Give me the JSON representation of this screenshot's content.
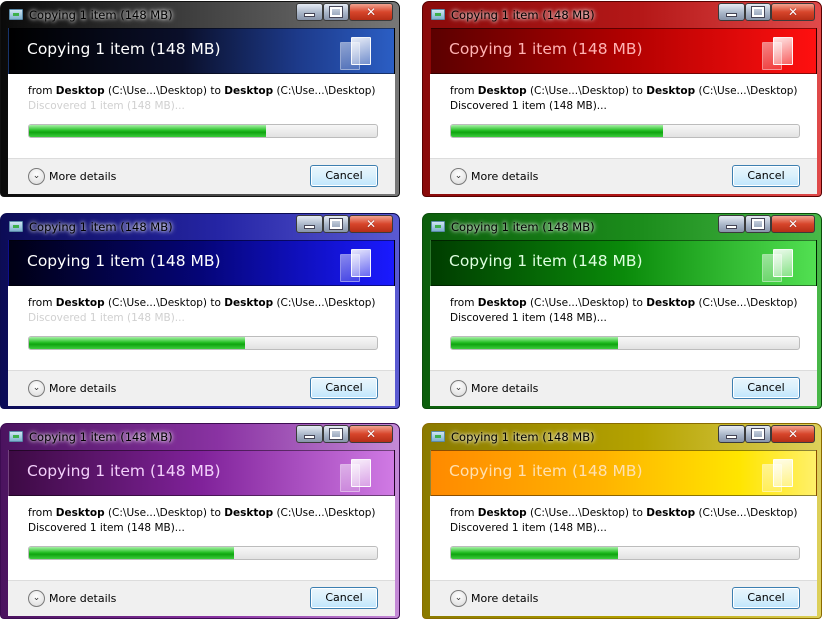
{
  "dialogs": [
    {
      "theme": "black",
      "window_title": "Copying 1 item (148 MB)",
      "heading": "Copying 1 item (148 MB)",
      "from_label": "from",
      "source_name": "Desktop",
      "source_path": "(C:\\Use...\\Desktop)",
      "to_label": "to",
      "dest_name": "Desktop",
      "dest_path": "(C:\\Use...\\Desktop)",
      "status": "Discovered 1 item (148 MB)...",
      "progress_percent": 68,
      "more_details": "More details",
      "cancel": "Cancel"
    },
    {
      "theme": "red",
      "window_title": "Copying 1 item (148 MB)",
      "heading": "Copying 1 item (148 MB)",
      "from_label": "from",
      "source_name": "Desktop",
      "source_path": "(C:\\Use...\\Desktop)",
      "to_label": "to",
      "dest_name": "Desktop",
      "dest_path": "(C:\\Use...\\Desktop)",
      "status": "Discovered 1 item (148 MB)...",
      "progress_percent": 61,
      "more_details": "More details",
      "cancel": "Cancel"
    },
    {
      "theme": "blue",
      "window_title": "Copying 1 item (148 MB)",
      "heading": "Copying 1 item (148 MB)",
      "from_label": "from",
      "source_name": "Desktop",
      "source_path": "(C:\\Use...\\Desktop)",
      "to_label": "to",
      "dest_name": "Desktop",
      "dest_path": "(C:\\Use...\\Desktop)",
      "status": "Discovered 1 item (148 MB)...",
      "progress_percent": 62,
      "more_details": "More details",
      "cancel": "Cancel"
    },
    {
      "theme": "green",
      "window_title": "Copying 1 item (148 MB)",
      "heading": "Copying 1 item (148 MB)",
      "from_label": "from",
      "source_name": "Desktop",
      "source_path": "(C:\\Use...\\Desktop)",
      "to_label": "to",
      "dest_name": "Desktop",
      "dest_path": "(C:\\Use...\\Desktop)",
      "status": "Discovered 1 item (148 MB)...",
      "progress_percent": 48,
      "more_details": "More details",
      "cancel": "Cancel"
    },
    {
      "theme": "purple",
      "window_title": "Copying 1 item (148 MB)",
      "heading": "Copying 1 item (148 MB)",
      "from_label": "from",
      "source_name": "Desktop",
      "source_path": "(C:\\Use...\\Desktop)",
      "to_label": "to",
      "dest_name": "Desktop",
      "dest_path": "(C:\\Use...\\Desktop)",
      "status": "Discovered 1 item (148 MB)...",
      "progress_percent": 59,
      "more_details": "More details",
      "cancel": "Cancel"
    },
    {
      "theme": "yellow",
      "window_title": "Copying 1 item (148 MB)",
      "heading": "Copying 1 item (148 MB)",
      "from_label": "from",
      "source_name": "Desktop",
      "source_path": "(C:\\Use...\\Desktop)",
      "to_label": "to",
      "dest_name": "Desktop",
      "dest_path": "(C:\\Use...\\Desktop)",
      "status": "Discovered 1 item (148 MB)...",
      "progress_percent": 48,
      "more_details": "More details",
      "cancel": "Cancel"
    }
  ],
  "icons": {
    "app": "copy-window-icon",
    "minimize": "minimize-icon",
    "maximize": "maximize-icon",
    "close": "close-icon",
    "header": "copy-files-icon",
    "more_details": "chevron-down-icon"
  }
}
